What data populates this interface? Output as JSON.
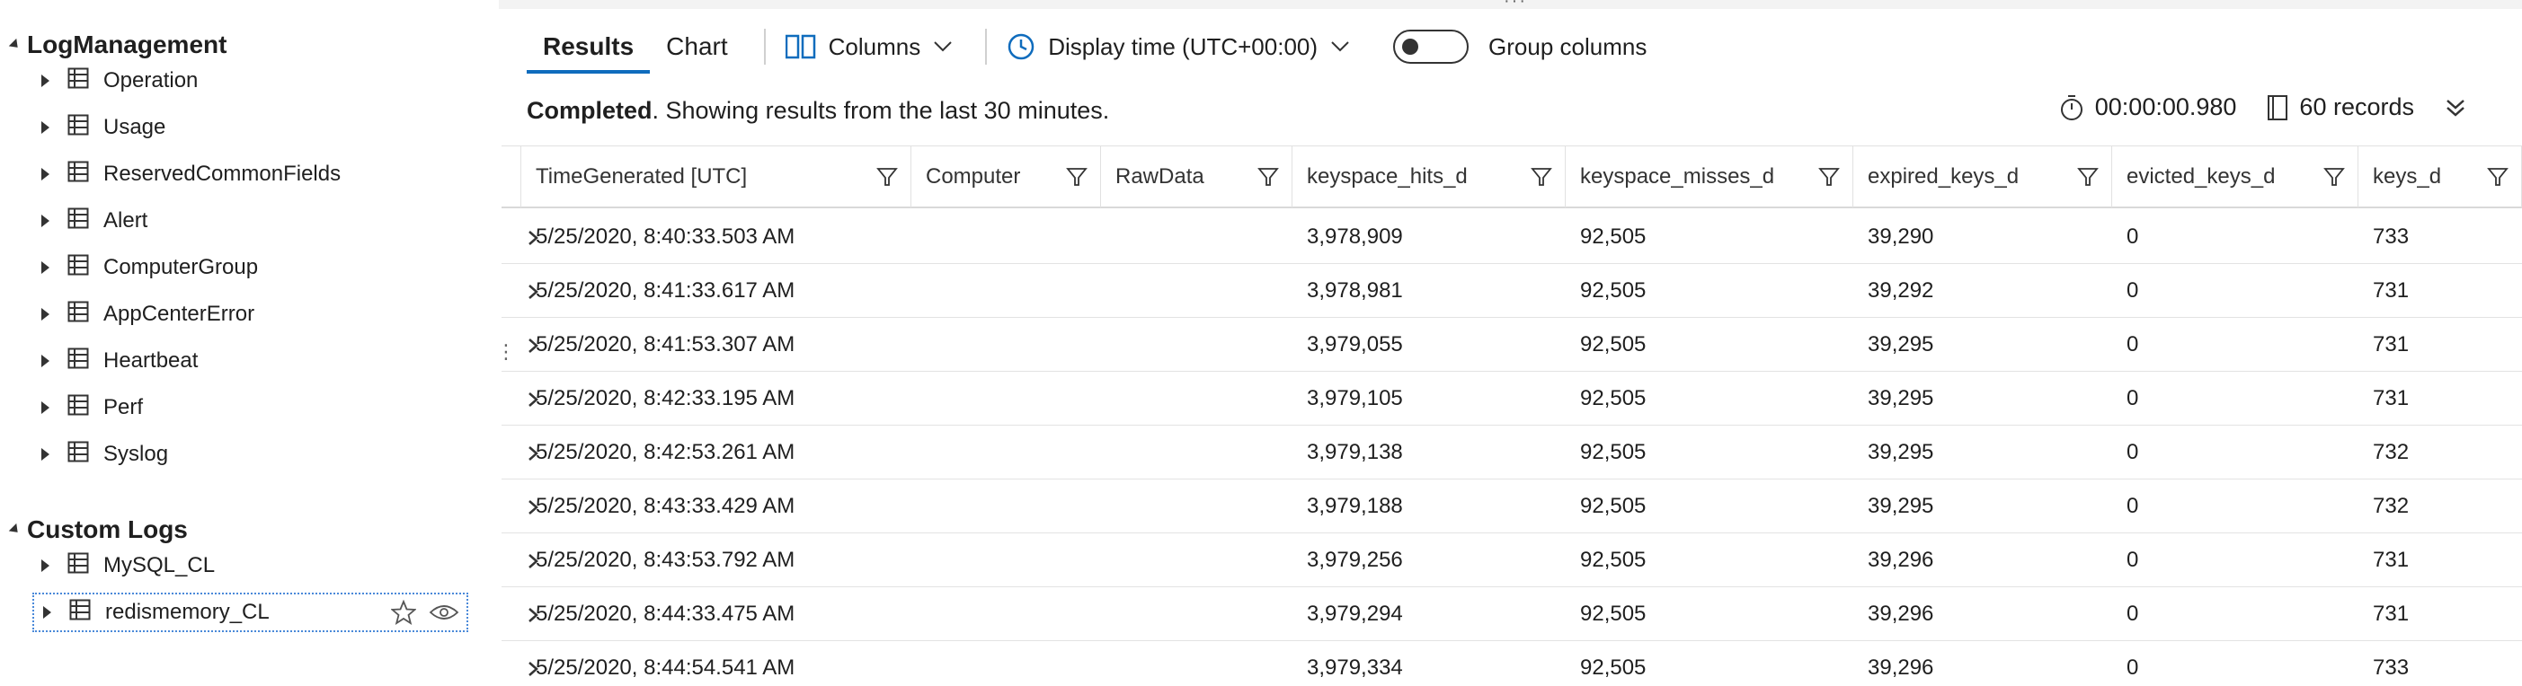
{
  "sidebar": {
    "groups": [
      {
        "title": "LogManagement",
        "items": [
          "Operation",
          "Usage",
          "ReservedCommonFields",
          "Alert",
          "ComputerGroup",
          "AppCenterError",
          "Heartbeat",
          "Perf",
          "Syslog"
        ]
      },
      {
        "title": "Custom Logs",
        "items": [
          "MySQL_CL",
          "redismemory_CL"
        ]
      }
    ],
    "selected_item": "redismemory_CL"
  },
  "toolbar": {
    "tabs": [
      "Results",
      "Chart"
    ],
    "active_tab": "Results",
    "columns_label": "Columns",
    "display_time_label": "Display time (UTC+00:00)",
    "group_columns_label": "Group columns",
    "group_columns_on": false
  },
  "status": {
    "state": "Completed",
    "message": ". Showing results from the last 30 minutes.",
    "duration": "00:00:00.980",
    "records": "60 records"
  },
  "table": {
    "columns": [
      "TimeGenerated [UTC]",
      "Computer",
      "RawData",
      "keyspace_hits_d",
      "keyspace_misses_d",
      "expired_keys_d",
      "evicted_keys_d",
      "keys_d"
    ],
    "rows": [
      [
        "5/25/2020, 8:40:33.503 AM",
        "",
        "",
        "3,978,909",
        "92,505",
        "39,290",
        "0",
        "733"
      ],
      [
        "5/25/2020, 8:41:33.617 AM",
        "",
        "",
        "3,978,981",
        "92,505",
        "39,292",
        "0",
        "731"
      ],
      [
        "5/25/2020, 8:41:53.307 AM",
        "",
        "",
        "3,979,055",
        "92,505",
        "39,295",
        "0",
        "731"
      ],
      [
        "5/25/2020, 8:42:33.195 AM",
        "",
        "",
        "3,979,105",
        "92,505",
        "39,295",
        "0",
        "731"
      ],
      [
        "5/25/2020, 8:42:53.261 AM",
        "",
        "",
        "3,979,138",
        "92,505",
        "39,295",
        "0",
        "732"
      ],
      [
        "5/25/2020, 8:43:33.429 AM",
        "",
        "",
        "3,979,188",
        "92,505",
        "39,295",
        "0",
        "732"
      ],
      [
        "5/25/2020, 8:43:53.792 AM",
        "",
        "",
        "3,979,256",
        "92,505",
        "39,296",
        "0",
        "731"
      ],
      [
        "5/25/2020, 8:44:33.475 AM",
        "",
        "",
        "3,979,294",
        "92,505",
        "39,296",
        "0",
        "731"
      ],
      [
        "5/25/2020, 8:44:54.541 AM",
        "",
        "",
        "3,979,334",
        "92,505",
        "39,296",
        "0",
        "733"
      ]
    ]
  },
  "colors": {
    "accent": "#0f6cbd",
    "icon_blue": "#0f6cbd",
    "text": "#1f1f1f",
    "grid_line": "#e3e3e3"
  }
}
